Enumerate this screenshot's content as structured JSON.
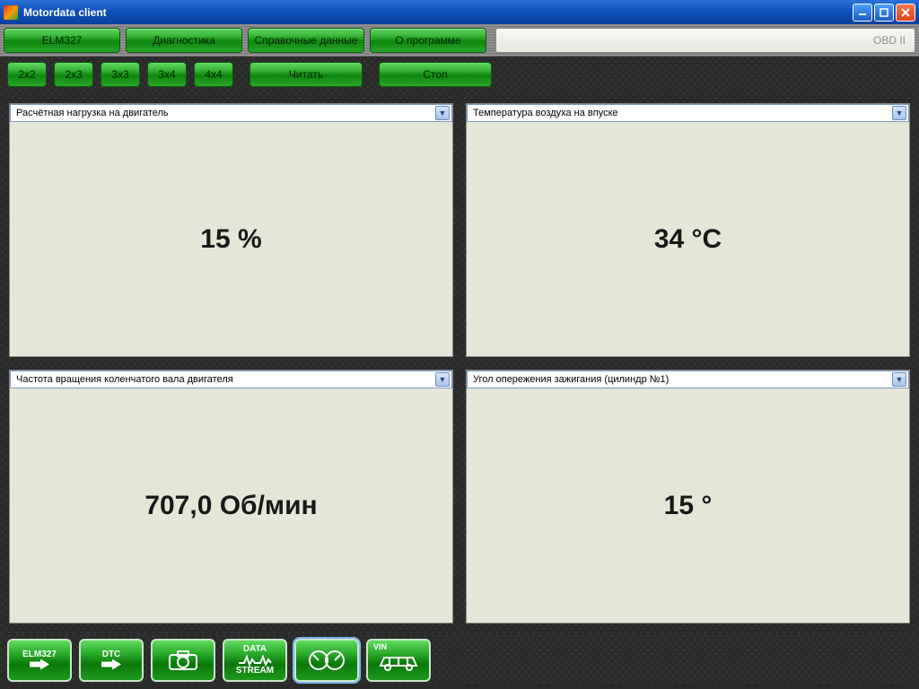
{
  "window": {
    "title": "Motordata client"
  },
  "tabs": {
    "elm": "ELM327",
    "diag": "Диагностика",
    "ref": "Справочные данные",
    "about": "О программе"
  },
  "protocol_hint": "OBD II",
  "layout_buttons": [
    "2x2",
    "2x3",
    "3x3",
    "3x4",
    "4x4"
  ],
  "actions": {
    "read": "Читать",
    "stop": "Стоп"
  },
  "panels": [
    {
      "param": "Расчётная нагрузка на двигатель",
      "value": "15 %"
    },
    {
      "param": "Температура воздуха на впуске",
      "value": "34 °C"
    },
    {
      "param": "Частота вращения коленчатого вала двигателя",
      "value": "707,0 Об/мин"
    },
    {
      "param": "Угол опережения зажигания (цилиндр №1)",
      "value": "15 °"
    }
  ],
  "footer": {
    "elm": "ELM327",
    "dtc": "DTC",
    "camera": "camera",
    "data": "DATA",
    "stream": "STREAM",
    "gauges": "gauges",
    "vin": "VIN"
  }
}
